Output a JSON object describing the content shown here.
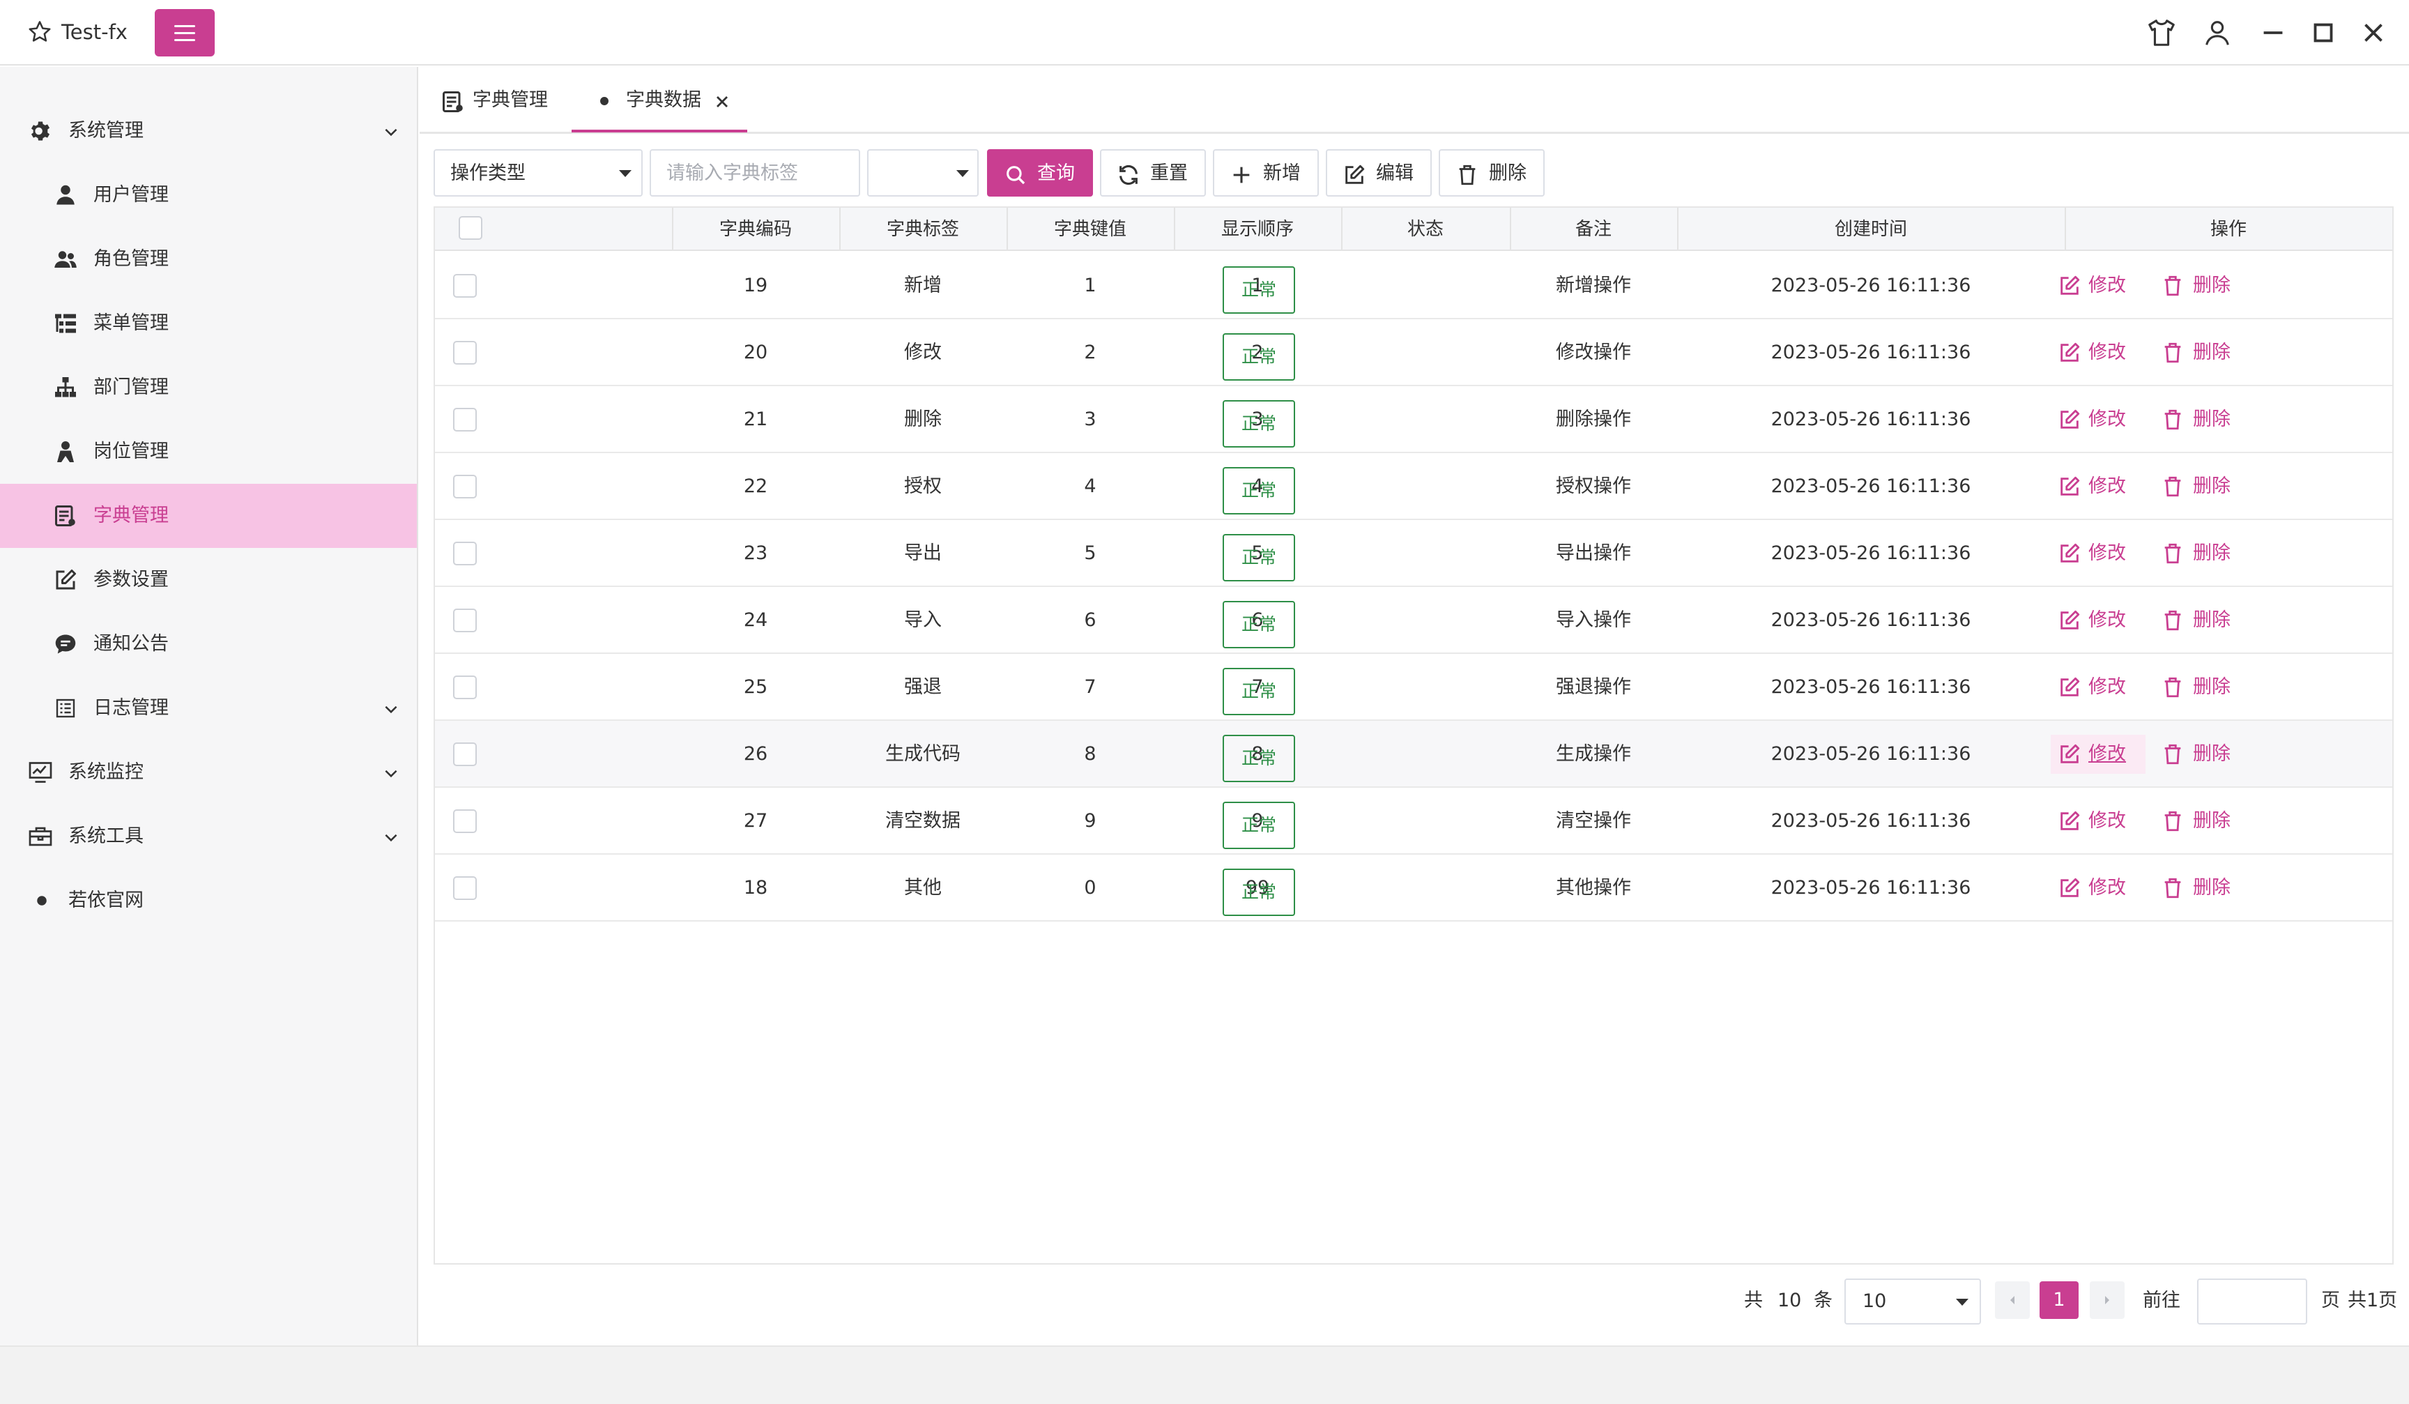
{
  "app": {
    "title": "Test-fx"
  },
  "sidebar": {
    "items": [
      {
        "label": "系统管理",
        "icon": "gear-icon"
      },
      {
        "label": "用户管理",
        "icon": "user-icon"
      },
      {
        "label": "角色管理",
        "icon": "users-icon"
      },
      {
        "label": "菜单管理",
        "icon": "tree-list-icon"
      },
      {
        "label": "部门管理",
        "icon": "org-chart-icon"
      },
      {
        "label": "岗位管理",
        "icon": "post-icon"
      },
      {
        "label": "字典管理",
        "icon": "dictionary-icon"
      },
      {
        "label": "参数设置",
        "icon": "edit-icon"
      },
      {
        "label": "通知公告",
        "icon": "chat-icon"
      },
      {
        "label": "日志管理",
        "icon": "list-icon"
      },
      {
        "label": "系统监控",
        "icon": "monitor-icon"
      },
      {
        "label": "系统工具",
        "icon": "toolbox-icon"
      },
      {
        "label": "若依官网",
        "icon": "dot-icon"
      }
    ],
    "active": "字典管理"
  },
  "tabs": [
    {
      "label": "字典管理",
      "icon": "dictionary-icon"
    },
    {
      "label": "字典数据",
      "icon": "dot-icon",
      "closable": true
    }
  ],
  "toolbar": {
    "type_select_value": "操作类型",
    "label_input_placeholder": "请输入字典标签",
    "status_select_value": "",
    "search_label": "查询",
    "reset_label": "重置",
    "add_label": "新增",
    "edit_label": "编辑",
    "delete_label": "删除"
  },
  "table": {
    "columns": [
      "字典编码",
      "字典标签",
      "字典键值",
      "显示顺序",
      "状态",
      "备注",
      "创建时间",
      "操作"
    ],
    "rows": [
      {
        "code": "19",
        "label": "新增",
        "value": "1",
        "sort": "1",
        "status": "正常",
        "remark": "新增操作",
        "created": "2023-05-26 16:11:36"
      },
      {
        "code": "20",
        "label": "修改",
        "value": "2",
        "sort": "2",
        "status": "正常",
        "remark": "修改操作",
        "created": "2023-05-26 16:11:36"
      },
      {
        "code": "21",
        "label": "删除",
        "value": "3",
        "sort": "3",
        "status": "正常",
        "remark": "删除操作",
        "created": "2023-05-26 16:11:36"
      },
      {
        "code": "22",
        "label": "授权",
        "value": "4",
        "sort": "4",
        "status": "正常",
        "remark": "授权操作",
        "created": "2023-05-26 16:11:36"
      },
      {
        "code": "23",
        "label": "导出",
        "value": "5",
        "sort": "5",
        "status": "正常",
        "remark": "导出操作",
        "created": "2023-05-26 16:11:36"
      },
      {
        "code": "24",
        "label": "导入",
        "value": "6",
        "sort": "6",
        "status": "正常",
        "remark": "导入操作",
        "created": "2023-05-26 16:11:36"
      },
      {
        "code": "25",
        "label": "强退",
        "value": "7",
        "sort": "7",
        "status": "正常",
        "remark": "强退操作",
        "created": "2023-05-26 16:11:36"
      },
      {
        "code": "26",
        "label": "生成代码",
        "value": "8",
        "sort": "8",
        "status": "正常",
        "remark": "生成操作",
        "created": "2023-05-26 16:11:36"
      },
      {
        "code": "27",
        "label": "清空数据",
        "value": "9",
        "sort": "9",
        "status": "正常",
        "remark": "清空操作",
        "created": "2023-05-26 16:11:36"
      },
      {
        "code": "18",
        "label": "其他",
        "value": "0",
        "sort": "99",
        "status": "正常",
        "remark": "其他操作",
        "created": "2023-05-26 16:11:36"
      }
    ],
    "row_actions": {
      "edit": "修改",
      "delete": "删除"
    }
  },
  "pagination": {
    "total_prefix": "共",
    "total": "10",
    "total_suffix": "条",
    "page_size": "10",
    "current_page": "1",
    "goto_label": "前往",
    "goto_value": "",
    "page_suffix": "页",
    "pages_text": "共1页"
  },
  "colors": {
    "accent": "#c93e91",
    "active_bg": "#f7c3e4",
    "status_green": "#2e8f47"
  }
}
